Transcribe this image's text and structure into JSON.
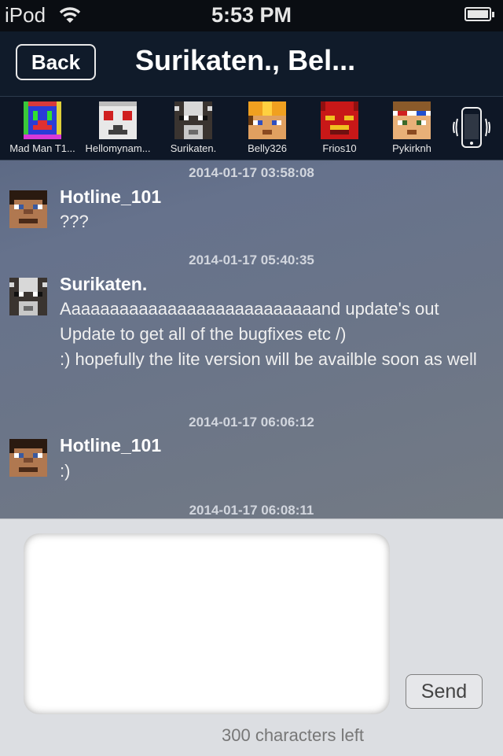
{
  "status_bar": {
    "carrier": "iPod",
    "time": "5:53 PM",
    "battery_level": 0.88
  },
  "nav": {
    "back_label": "Back",
    "title": "Surikaten., Bel..."
  },
  "participants": [
    {
      "name": "Mad Man T1...",
      "icon": "blue-creeper-avatar-icon"
    },
    {
      "name": "Hellomynam...",
      "icon": "white-ghast-avatar-icon"
    },
    {
      "name": "Surikaten.",
      "icon": "cow-avatar-icon"
    },
    {
      "name": "Belly326",
      "icon": "hardhat-avatar-icon"
    },
    {
      "name": "Frios10",
      "icon": "red-demon-avatar-icon"
    },
    {
      "name": "Pykirknh",
      "icon": "3d-glasses-avatar-icon"
    }
  ],
  "messages": [
    {
      "timestamp": "2014-01-17 03:58:08",
      "sender": "Hotline_101",
      "text": "???",
      "avatar": "steve-avatar-icon"
    },
    {
      "timestamp": "2014-01-17 05:40:35",
      "sender": "Surikaten.",
      "text": "Aaaaaaaaaaaaaaaaaaaaaaaaaaand update's out\nUpdate to get all of the bugfixes etc /)\n:) hopefully the lite version will be availble soon as well",
      "avatar": "cow-avatar-icon"
    },
    {
      "timestamp": "2014-01-17 06:06:12",
      "sender": "Hotline_101",
      "text": ":)",
      "avatar": "steve-avatar-icon"
    },
    {
      "timestamp": "2014-01-17 06:08:11"
    }
  ],
  "compose": {
    "send_label": "Send",
    "characters_left": "300 characters left",
    "input_value": ""
  }
}
